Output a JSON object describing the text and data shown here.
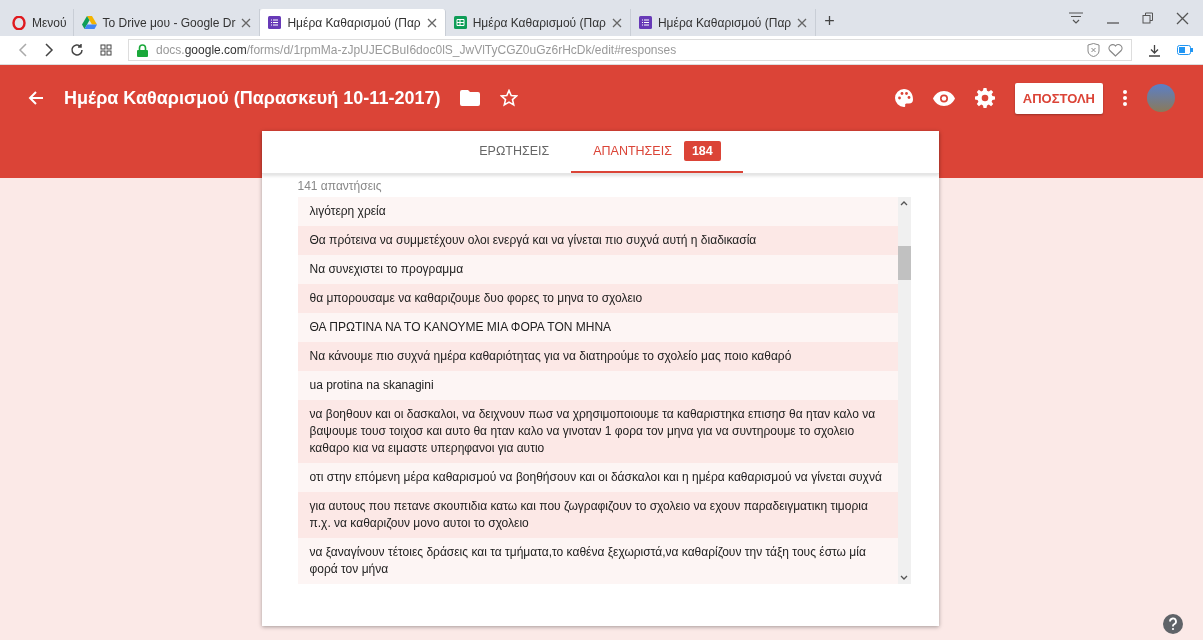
{
  "browser": {
    "menu_label": "Μενού",
    "tabs": [
      {
        "title": "To Drive μου - Google Dr",
        "kind": "drive",
        "selected": false
      },
      {
        "title": "Ημέρα Καθαρισμού (Παρ",
        "kind": "form",
        "selected": true
      },
      {
        "title": "Ημέρα Καθαρισμού (Παρ",
        "kind": "sheet",
        "selected": false
      },
      {
        "title": "Ημέρα Καθαρισμού (Παρ",
        "kind": "form",
        "selected": false
      }
    ],
    "new_tab": "+",
    "url_prefix": "docs.",
    "url_domain": "google.com",
    "url_path": "/forms/d/1rpmMa-zJpUJECBuI6doc0lS_JwVlTyCGZ0uGz6rHcDk/edit#responses"
  },
  "header": {
    "title": "Ημέρα Καθαρισμού (Παρασκευή 10-11-2017)",
    "send_button": "ΑΠΟΣΤΟΛΗ"
  },
  "tabs": [
    {
      "label": "ΕΡΩΤΗΣΕΙΣ",
      "selected": false
    },
    {
      "label": "ΑΠΑΝΤΗΣΕΙΣ",
      "selected": true,
      "badge": "184"
    }
  ],
  "response_count": "141 απαντήσεις",
  "responses": [
    "λιγότερη χρεία",
    "Θα πρότεινα να συμμετέχουν ολοι ενεργά και να γίνεται πιο συχνά αυτή η διαδικασία",
    "Να συνεχιστει το προγραμμα",
    "θα μπορουσαμε να καθαριζουμε δυο φορες το μηνα το σχολειο",
    "ΘΑ ΠΡΩΤΙΝΑ ΝΑ ΤΟ ΚΑΝΟΥΜΕ ΜΙΑ ΦΟΡΑ ΤΟΝ ΜΗΝΑ",
    "Να κάνουμε πιο συχνά ημέρα καθαριότητας για να διατηρούμε το σχολείο μας ποιο καθαρό",
    "ua protina na skanagini",
    "να βοηθουν και οι δασκαλοι, να δειχνουν πωσ να χρησιμοποιουμε τα καθαριστηκα επισησ θα ηταν καλο να βαψουμε τουσ τοιχοσ και αυτο θα ηταν καλο να γινοταν 1 φορα τον μηνα για να συντηρουμε το σχολειο καθαρο κια να ειμαστε υπερηφανοι για αυτιο",
    "οτι στην επόμενη μέρα καθαρισμού να βοηθήσουν και οι δάσκαλοι και η ημέρα καθαρισμού να γίνεται συχνά",
    "για αυτους που πετανε σκουπιδια κατω και που ζωγραφιζουν το σχολειο να εχουν παραδειγματικη τιμορια π.χ. να καθαριζουν μονο αυτοι το σχολειο",
    "να ξαναγίνουν τέτοιες δράσεις και τα τμήματα,το καθένα ξεχωριστά,να καθαρίζουν την τάξη τους έστω μία φορά τον μήνα"
  ]
}
